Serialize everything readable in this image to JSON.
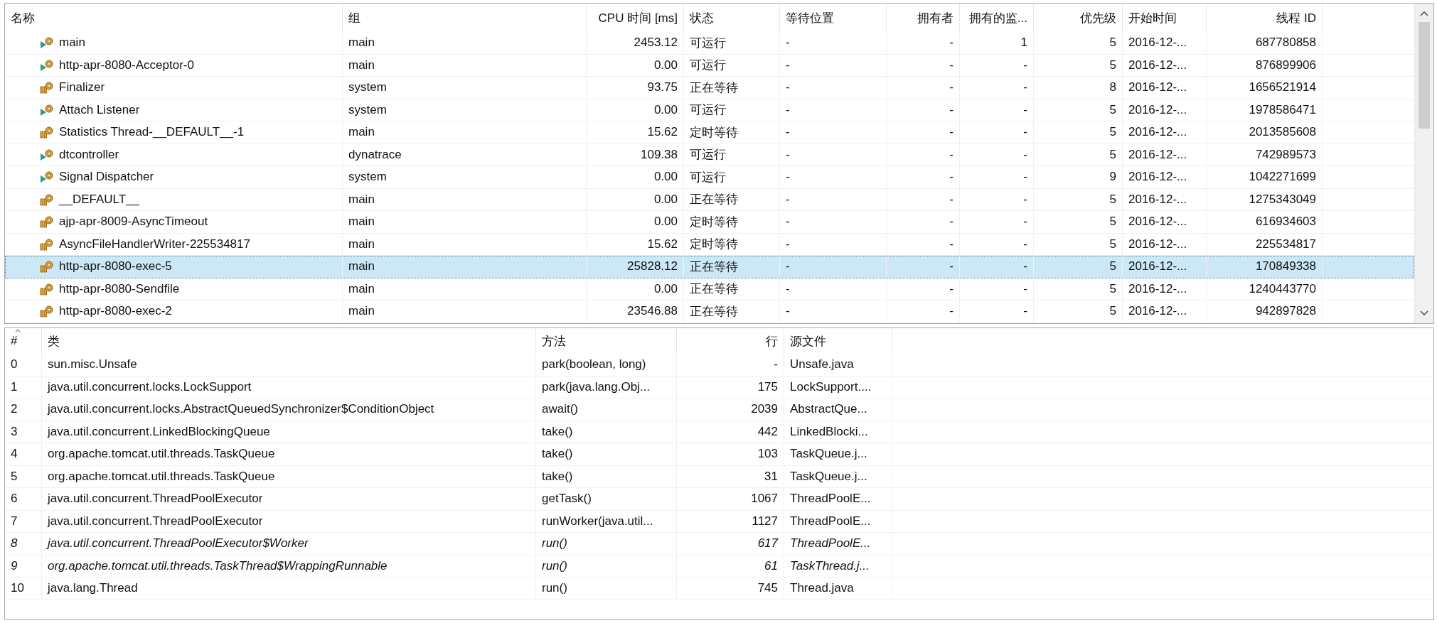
{
  "threads": {
    "columns": [
      "名称",
      "组",
      "CPU 时间 [ms]",
      "状态",
      "等待位置",
      "拥有者",
      "拥有的监...",
      "优先级",
      "开始时间",
      "线程 ID"
    ],
    "rows": [
      {
        "kind": "running",
        "selected": false,
        "cells": [
          "main",
          "main",
          "2453.12",
          "可运行",
          "-",
          "-",
          "1",
          "5",
          "2016-12-...",
          "687780858"
        ]
      },
      {
        "kind": "running",
        "selected": false,
        "cells": [
          "http-apr-8080-Acceptor-0",
          "main",
          "0.00",
          "可运行",
          "-",
          "-",
          "-",
          "5",
          "2016-12-...",
          "876899906"
        ]
      },
      {
        "kind": "waiting",
        "selected": false,
        "cells": [
          "Finalizer",
          "system",
          "93.75",
          "正在等待",
          "-",
          "-",
          "-",
          "8",
          "2016-12-...",
          "1656521914"
        ]
      },
      {
        "kind": "running",
        "selected": false,
        "cells": [
          "Attach Listener",
          "system",
          "0.00",
          "可运行",
          "-",
          "-",
          "-",
          "5",
          "2016-12-...",
          "1978586471"
        ]
      },
      {
        "kind": "waiting",
        "selected": false,
        "cells": [
          "Statistics Thread-__DEFAULT__-1",
          "main",
          "15.62",
          "定时等待",
          "-",
          "-",
          "-",
          "5",
          "2016-12-...",
          "2013585608"
        ]
      },
      {
        "kind": "running",
        "selected": false,
        "cells": [
          "dtcontroller",
          "dynatrace",
          "109.38",
          "可运行",
          "-",
          "-",
          "-",
          "5",
          "2016-12-...",
          "742989573"
        ]
      },
      {
        "kind": "running",
        "selected": false,
        "cells": [
          "Signal Dispatcher",
          "system",
          "0.00",
          "可运行",
          "-",
          "-",
          "-",
          "9",
          "2016-12-...",
          "1042271699"
        ]
      },
      {
        "kind": "waiting",
        "selected": false,
        "cells": [
          "__DEFAULT__",
          "main",
          "0.00",
          "正在等待",
          "-",
          "-",
          "-",
          "5",
          "2016-12-...",
          "1275343049"
        ]
      },
      {
        "kind": "waiting",
        "selected": false,
        "cells": [
          "ajp-apr-8009-AsyncTimeout",
          "main",
          "0.00",
          "定时等待",
          "-",
          "-",
          "-",
          "5",
          "2016-12-...",
          "616934603"
        ]
      },
      {
        "kind": "waiting",
        "selected": false,
        "cells": [
          "AsyncFileHandlerWriter-225534817",
          "main",
          "15.62",
          "定时等待",
          "-",
          "-",
          "-",
          "5",
          "2016-12-...",
          "225534817"
        ]
      },
      {
        "kind": "waiting",
        "selected": true,
        "cells": [
          "http-apr-8080-exec-5",
          "main",
          "25828.12",
          "正在等待",
          "-",
          "-",
          "-",
          "5",
          "2016-12-...",
          "170849338"
        ]
      },
      {
        "kind": "waiting",
        "selected": false,
        "cells": [
          "http-apr-8080-Sendfile",
          "main",
          "0.00",
          "正在等待",
          "-",
          "-",
          "-",
          "5",
          "2016-12-...",
          "1240443770"
        ]
      },
      {
        "kind": "waiting",
        "selected": false,
        "cells": [
          "http-apr-8080-exec-2",
          "main",
          "23546.88",
          "正在等待",
          "-",
          "-",
          "-",
          "5",
          "2016-12-...",
          "942897828"
        ]
      }
    ]
  },
  "stack": {
    "columns": [
      "#",
      "类",
      "方法",
      "行",
      "源文件"
    ],
    "rows": [
      {
        "italic": false,
        "cells": [
          "0",
          "sun.misc.Unsafe",
          "park(boolean, long)",
          "-",
          "Unsafe.java"
        ]
      },
      {
        "italic": false,
        "cells": [
          "1",
          "java.util.concurrent.locks.LockSupport",
          "park(java.lang.Obj...",
          "175",
          "LockSupport...."
        ]
      },
      {
        "italic": false,
        "cells": [
          "2",
          "java.util.concurrent.locks.AbstractQueuedSynchronizer$ConditionObject",
          "await()",
          "2039",
          "AbstractQue..."
        ]
      },
      {
        "italic": false,
        "cells": [
          "3",
          "java.util.concurrent.LinkedBlockingQueue",
          "take()",
          "442",
          "LinkedBlocki..."
        ]
      },
      {
        "italic": false,
        "cells": [
          "4",
          "org.apache.tomcat.util.threads.TaskQueue",
          "take()",
          "103",
          "TaskQueue.j..."
        ]
      },
      {
        "italic": false,
        "cells": [
          "5",
          "org.apache.tomcat.util.threads.TaskQueue",
          "take()",
          "31",
          "TaskQueue.j..."
        ]
      },
      {
        "italic": false,
        "cells": [
          "6",
          "java.util.concurrent.ThreadPoolExecutor",
          "getTask()",
          "1067",
          "ThreadPoolE..."
        ]
      },
      {
        "italic": false,
        "cells": [
          "7",
          "java.util.concurrent.ThreadPoolExecutor",
          "runWorker(java.util...",
          "1127",
          "ThreadPoolE..."
        ]
      },
      {
        "italic": true,
        "cells": [
          "8",
          "java.util.concurrent.ThreadPoolExecutor$Worker",
          "run()",
          "617",
          "ThreadPoolE..."
        ]
      },
      {
        "italic": true,
        "cells": [
          "9",
          "org.apache.tomcat.util.threads.TaskThread$WrappingRunnable",
          "run()",
          "61",
          "TaskThread.j..."
        ]
      },
      {
        "italic": false,
        "cells": [
          "10",
          "java.lang.Thread",
          "run()",
          "745",
          "Thread.java"
        ]
      }
    ]
  }
}
